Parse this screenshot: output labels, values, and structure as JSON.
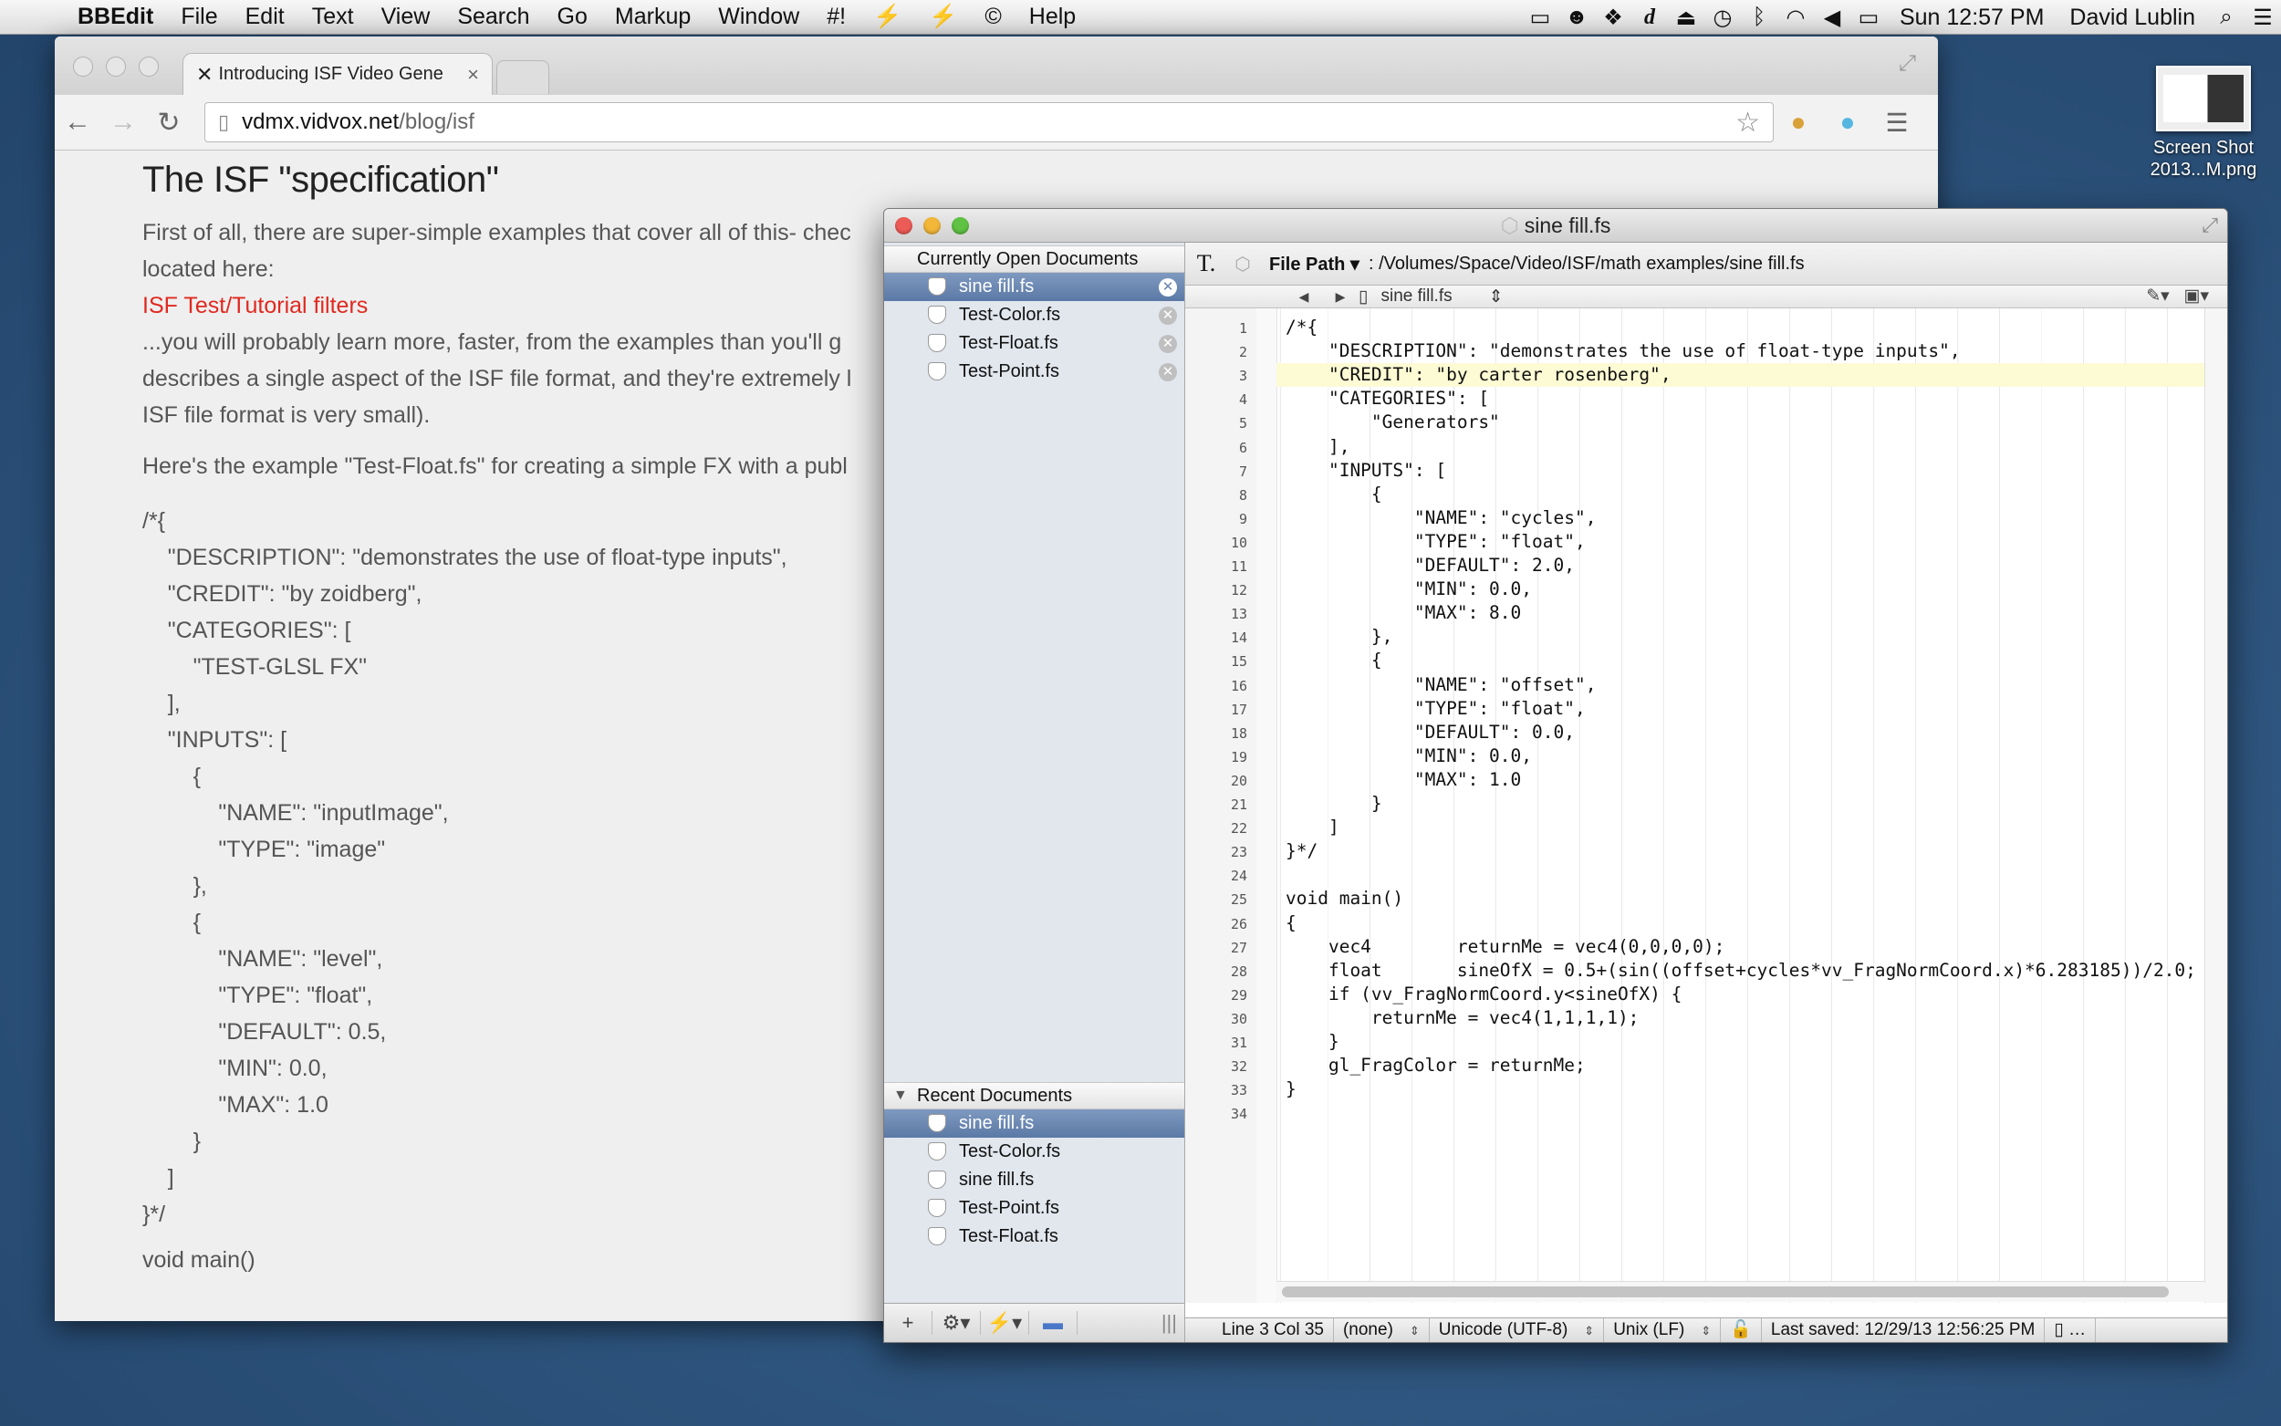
{
  "menubar": {
    "app": "BBEdit",
    "items": [
      "File",
      "Edit",
      "Text",
      "View",
      "Search",
      "Go",
      "Markup",
      "Window",
      "#!",
      "⚡",
      "⚡",
      "©",
      "Help"
    ],
    "clock": "Sun 12:57 PM",
    "user": "David Lublin"
  },
  "desktop": {
    "icon_label_1": "Screen Shot",
    "icon_label_2": "2013...M.png"
  },
  "browser": {
    "tab_title": "Introducing ISF Video Gene",
    "url_domain": "vdmx.vidvox.net",
    "url_path": "/blog/isf",
    "page": {
      "heading": "The ISF \"specification\"",
      "p1_line1": "First of all, there are super-simple examples that cover all of this- chec",
      "p1_line2": "located here:",
      "link": "ISF Test/Tutorial filters",
      "p2_line1": "...you will probably learn more, faster, from the examples than you'll g",
      "p2_line2": "describes a single aspect of the ISF file format, and they're extremely l",
      "p2_line3": "ISF file format is very small).",
      "p3": "Here's the example \"Test-Float.fs\" for creating a simple FX with a publ",
      "code": "/*{\n    \"DESCRIPTION\": \"demonstrates the use of float-type inputs\",\n    \"CREDIT\": \"by zoidberg\",\n    \"CATEGORIES\": [\n        \"TEST-GLSL FX\"\n    ],\n    \"INPUTS\": [\n        {\n            \"NAME\": \"inputImage\",\n            \"TYPE\": \"image\"\n        },\n        {\n            \"NAME\": \"level\",\n            \"TYPE\": \"float\",\n            \"DEFAULT\": 0.5,\n            \"MIN\": 0.0,\n            \"MAX\": 1.0\n        }\n    ]\n}*/",
      "tail": "void main()"
    }
  },
  "bbedit": {
    "window_title": "sine fill.fs",
    "open_docs_header": "Currently Open Documents",
    "open_docs": [
      "sine fill.fs",
      "Test-Color.fs",
      "Test-Float.fs",
      "Test-Point.fs"
    ],
    "recent_docs_header": "Recent Documents",
    "recent_docs": [
      "sine fill.fs",
      "Test-Color.fs",
      "sine fill.fs",
      "Test-Point.fs",
      "Test-Float.fs"
    ],
    "file_path_label": "File Path ▾",
    "file_path": ": /Volumes/Space/Video/ISF/math examples/sine fill.fs",
    "func_menu": "sine fill.fs",
    "code_lines": [
      "/*{",
      "    \"DESCRIPTION\": \"demonstrates the use of float-type inputs\",",
      "    \"CREDIT\": \"by carter rosenberg\",",
      "    \"CATEGORIES\": [",
      "        \"Generators\"",
      "    ],",
      "    \"INPUTS\": [",
      "        {",
      "            \"NAME\": \"cycles\",",
      "            \"TYPE\": \"float\",",
      "            \"DEFAULT\": 2.0,",
      "            \"MIN\": 0.0,",
      "            \"MAX\": 8.0",
      "        },",
      "        {",
      "            \"NAME\": \"offset\",",
      "            \"TYPE\": \"float\",",
      "            \"DEFAULT\": 0.0,",
      "            \"MIN\": 0.0,",
      "            \"MAX\": 1.0",
      "        }",
      "    ]",
      "}*/",
      "",
      "void main()",
      "{",
      "    vec4        returnMe = vec4(0,0,0,0);",
      "    float       sineOfX = 0.5+(sin((offset+cycles*vv_FragNormCoord.x)*6.283185))/2.0;",
      "    if (vv_FragNormCoord.y<sineOfX) {",
      "        returnMe = vec4(1,1,1,1);",
      "    }",
      "    gl_FragColor = returnMe;",
      "}",
      ""
    ],
    "highlight_line": 3,
    "status": {
      "position": "Line 3 Col 35",
      "language": "(none)",
      "encoding": "Unicode (UTF-8)",
      "line_endings": "Unix (LF)",
      "saved": "Last saved: 12/29/13 12:56:25 PM"
    }
  }
}
